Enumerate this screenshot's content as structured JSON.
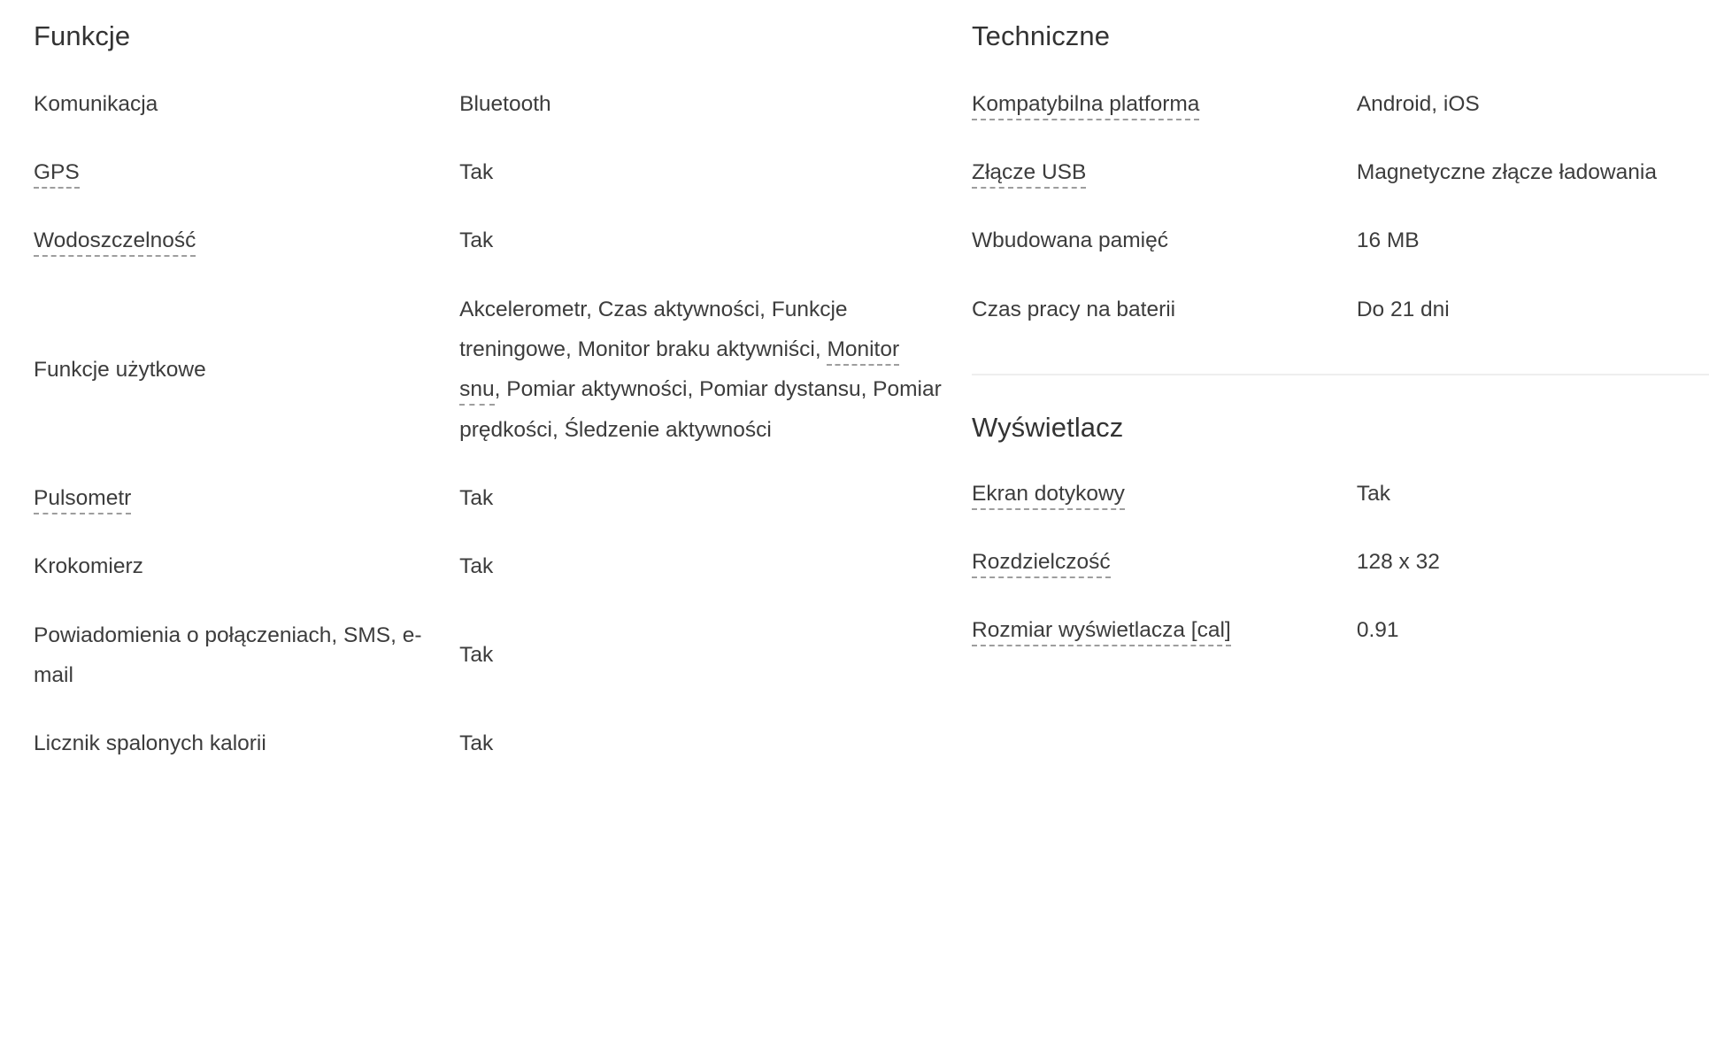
{
  "page": {
    "language": "pl",
    "text_color": "#3c3c3c",
    "heading_color": "#333333",
    "background": "#ffffff",
    "divider_color": "#eeeeee",
    "dotted_underline_color": "#9e9e9e"
  },
  "left_column": {
    "heading": "Funkcje",
    "rows": [
      {
        "label": "Komunikacja",
        "label_term": false,
        "value": "Bluetooth"
      },
      {
        "label": "GPS",
        "label_term": true,
        "value": "Tak"
      },
      {
        "label": "Wodoszczelność",
        "label_term": true,
        "value": "Tak"
      },
      {
        "label": "Funkcje użytkowe",
        "label_term": false,
        "value_parts": [
          {
            "text": "Akcelerometr, Czas aktywności, Funkcje treningowe, Monitor braku aktywniści, ",
            "term": false
          },
          {
            "text": "Monitor snu",
            "term": true
          },
          {
            "text": ", Pomiar aktywności, Pomiar dystansu, Pomiar prędkości, Śledzenie aktywności",
            "term": false
          }
        ],
        "value": "Akcelerometr, Czas aktywności, Funkcje treningowe, Monitor braku aktywniści, Monitor snu, Pomiar aktywności, Pomiar dystansu, Pomiar prędkości, Śledzenie aktywności"
      },
      {
        "label": "Pulsometr",
        "label_term": true,
        "value": "Tak"
      },
      {
        "label": "Krokomierz",
        "label_term": false,
        "value": "Tak"
      },
      {
        "label": "Powiadomienia o połączeniach, SMS, e-mail",
        "label_term": false,
        "value": "Tak"
      },
      {
        "label": "Licznik spalonych kalorii",
        "label_term": false,
        "value": "Tak"
      }
    ]
  },
  "right_column": {
    "technical": {
      "heading": "Techniczne",
      "rows": [
        {
          "label": "Kompatybilna platforma",
          "label_term": true,
          "value": "Android, iOS"
        },
        {
          "label": "Złącze USB",
          "label_term": true,
          "value": "Magnetyczne złącze ładowania"
        },
        {
          "label": "Wbudowana pamięć",
          "label_term": false,
          "value": "16 MB"
        },
        {
          "label": "Czas pracy na baterii",
          "label_term": false,
          "value": "Do 21 dni"
        }
      ]
    },
    "display": {
      "heading": "Wyświetlacz",
      "rows": [
        {
          "label": "Ekran dotykowy",
          "label_term": true,
          "value": "Tak"
        },
        {
          "label": "Rozdzielczość",
          "label_term": true,
          "value": "128 x 32"
        },
        {
          "label": "Rozmiar wyświetlacza [cal]",
          "label_term": true,
          "value": "0.91"
        }
      ]
    }
  }
}
